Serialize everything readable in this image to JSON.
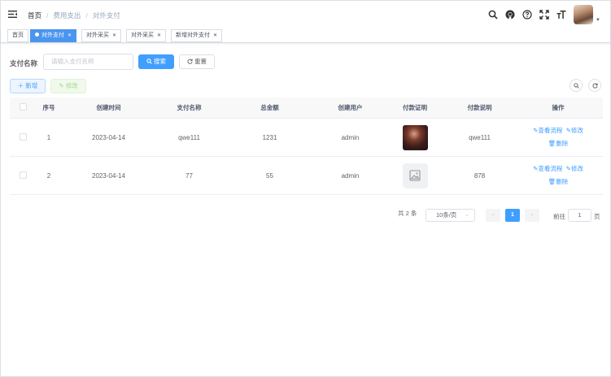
{
  "breadcrumb": [
    "首页",
    "费用支出",
    "对外支付"
  ],
  "tags": [
    {
      "label": "首页",
      "active": false,
      "closable": false
    },
    {
      "label": "对外支付",
      "active": true,
      "closable": true
    },
    {
      "label": "对外采买",
      "active": false,
      "closable": true
    },
    {
      "label": "对外采买",
      "active": false,
      "closable": true
    },
    {
      "label": "新增对外支付",
      "active": false,
      "closable": true
    }
  ],
  "search": {
    "label": "支付名称",
    "placeholder": "请输入支付名称",
    "search_btn": "搜索",
    "reset_btn": "重置"
  },
  "toolbar": {
    "add": "新增",
    "edit": "修改"
  },
  "table": {
    "columns": [
      "序号",
      "创建时间",
      "支付名称",
      "总金额",
      "创建用户",
      "付款证明",
      "付款说明",
      "操作"
    ],
    "rows": [
      {
        "index": "1",
        "created": "2023-04-14",
        "name": "qwe111",
        "amount": "1231",
        "user": "admin",
        "proof": "photo",
        "remark": "qwe111"
      },
      {
        "index": "2",
        "created": "2023-04-14",
        "name": "77",
        "amount": "55",
        "user": "admin",
        "proof": "placeholder",
        "remark": "878"
      }
    ],
    "actions": {
      "view": "查看流程",
      "edit": "修改",
      "delete": "删除"
    }
  },
  "pagination": {
    "total": "共 2 条",
    "page_size": "10条/页",
    "current": "1",
    "goto_label": "前往",
    "goto_value": "1",
    "page_suffix": "页"
  },
  "colors": {
    "primary": "#409eff",
    "tag_active": "#4a95ef"
  }
}
